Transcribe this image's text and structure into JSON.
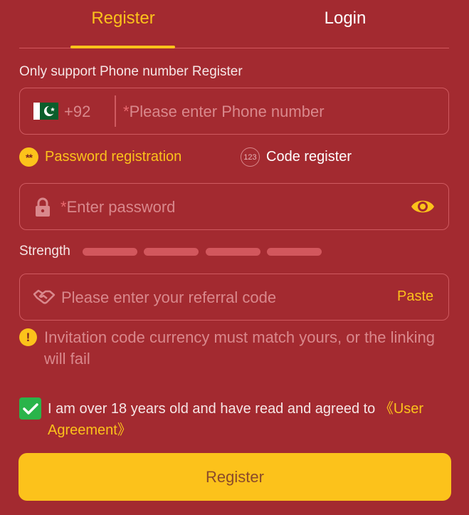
{
  "colors": {
    "background": "#a32a30",
    "accent": "#fcc21b",
    "placeholder": "#d9888c",
    "check": "#2ab44a"
  },
  "tabs": {
    "register": "Register",
    "login": "Login"
  },
  "note": "Only support Phone number Register",
  "phone": {
    "country_code": "+92",
    "placeholder_star": "*",
    "placeholder": "Please enter Phone number",
    "flag_icon": "pakistan-flag-icon"
  },
  "options": {
    "password_badge": "**",
    "password_label": "Password registration",
    "code_badge": "123",
    "code_label": "Code register",
    "selected": "Password registration"
  },
  "password": {
    "placeholder_star": "*",
    "placeholder": "Enter password",
    "icon": "lock-icon",
    "toggle_icon": "eye-icon"
  },
  "strength": {
    "label": "Strength",
    "level": 0,
    "segments": 4
  },
  "referral": {
    "placeholder": "Please enter your referral code",
    "paste": "Paste",
    "icon": "handshake-icon"
  },
  "warning": {
    "icon_text": "!",
    "text": "Invitation code currency must match yours, or the linking will fail"
  },
  "agreement": {
    "checked": true,
    "text": "I am over 18 years old and have read and agreed to ",
    "link": "《User Agreement》"
  },
  "submit_label": "Register"
}
